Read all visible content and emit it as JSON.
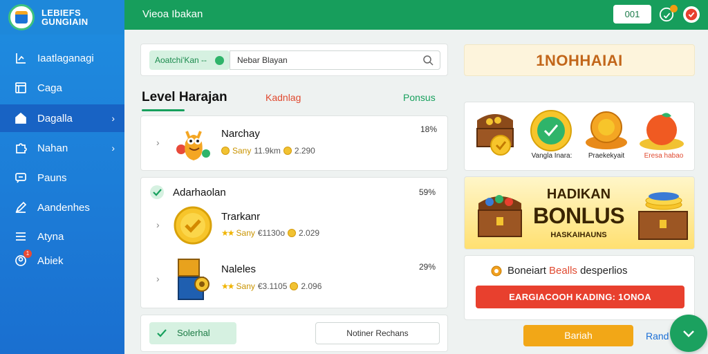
{
  "brand": {
    "line1": "LEBIEFS",
    "line2": "GUNGIAIN"
  },
  "sidebar": {
    "items": [
      {
        "label": "Iaatlaganagi",
        "icon": "chart-icon"
      },
      {
        "label": "Caga",
        "icon": "window-icon"
      },
      {
        "label": "Dagalla",
        "icon": "home-icon",
        "active": true,
        "chevron": "›"
      },
      {
        "label": "Nahan",
        "icon": "puzzle-icon",
        "chevron": "›"
      },
      {
        "label": "Pauns",
        "icon": "message-icon"
      },
      {
        "label": "Aandenhes",
        "icon": "pencil-icon"
      },
      {
        "label": "Atyna",
        "icon": "list-icon"
      },
      {
        "label": "Abiek",
        "icon": "user-icon",
        "badge": "1"
      }
    ]
  },
  "header": {
    "title": "Vieoa Ibakan",
    "button_label": "001"
  },
  "search": {
    "filter_label": "Aoatchi'Kan --",
    "value": "Nebar Blayan"
  },
  "tabs": {
    "active": "Level Harajan",
    "second": "Kadnlag",
    "third": "Ponsus"
  },
  "list": {
    "item1": {
      "title": "Narchay",
      "stat_label": "Sany",
      "stat_a": "11.9km",
      "stat_b": "2.290",
      "pct": "18%"
    },
    "group_title": "Adarhaolan",
    "group_pct": "59%",
    "item2": {
      "title": "Trarkanr",
      "stat_label": "Sany",
      "stat_a": "€1130o",
      "stat_b": "2.029",
      "pct": ""
    },
    "item3": {
      "title": "Naleles",
      "stat_label": "Sany",
      "stat_a": "€3.1105",
      "stat_b": "2.096",
      "pct": "29%"
    }
  },
  "right": {
    "banner_title": "1NOHHAIAI",
    "prizes": [
      {
        "label": ""
      },
      {
        "label": "Vangla Inara:"
      },
      {
        "label": "Praekekyait"
      },
      {
        "label": "Eresa habao"
      }
    ],
    "bonus": {
      "line1": "HADIKAN",
      "line2": "BONLUS",
      "line3": "HASKAIHAUNS"
    },
    "offer_text_a": "Boneiart",
    "offer_text_b": "Bealls",
    "offer_text_c": "desperlios",
    "offer_button": "EARGIACOOH KADING: 1ONOA"
  },
  "bottom": {
    "chip_label": "Solerhal",
    "outline_label": "Notiner Rechans",
    "yellow_button": "Bariah",
    "link": "Rand"
  },
  "colors": {
    "sidebar": "#1a73d6",
    "topbar": "#179e5c",
    "accent_green": "#17a05d",
    "accent_red": "#e8402e",
    "accent_orange": "#f2a717"
  }
}
